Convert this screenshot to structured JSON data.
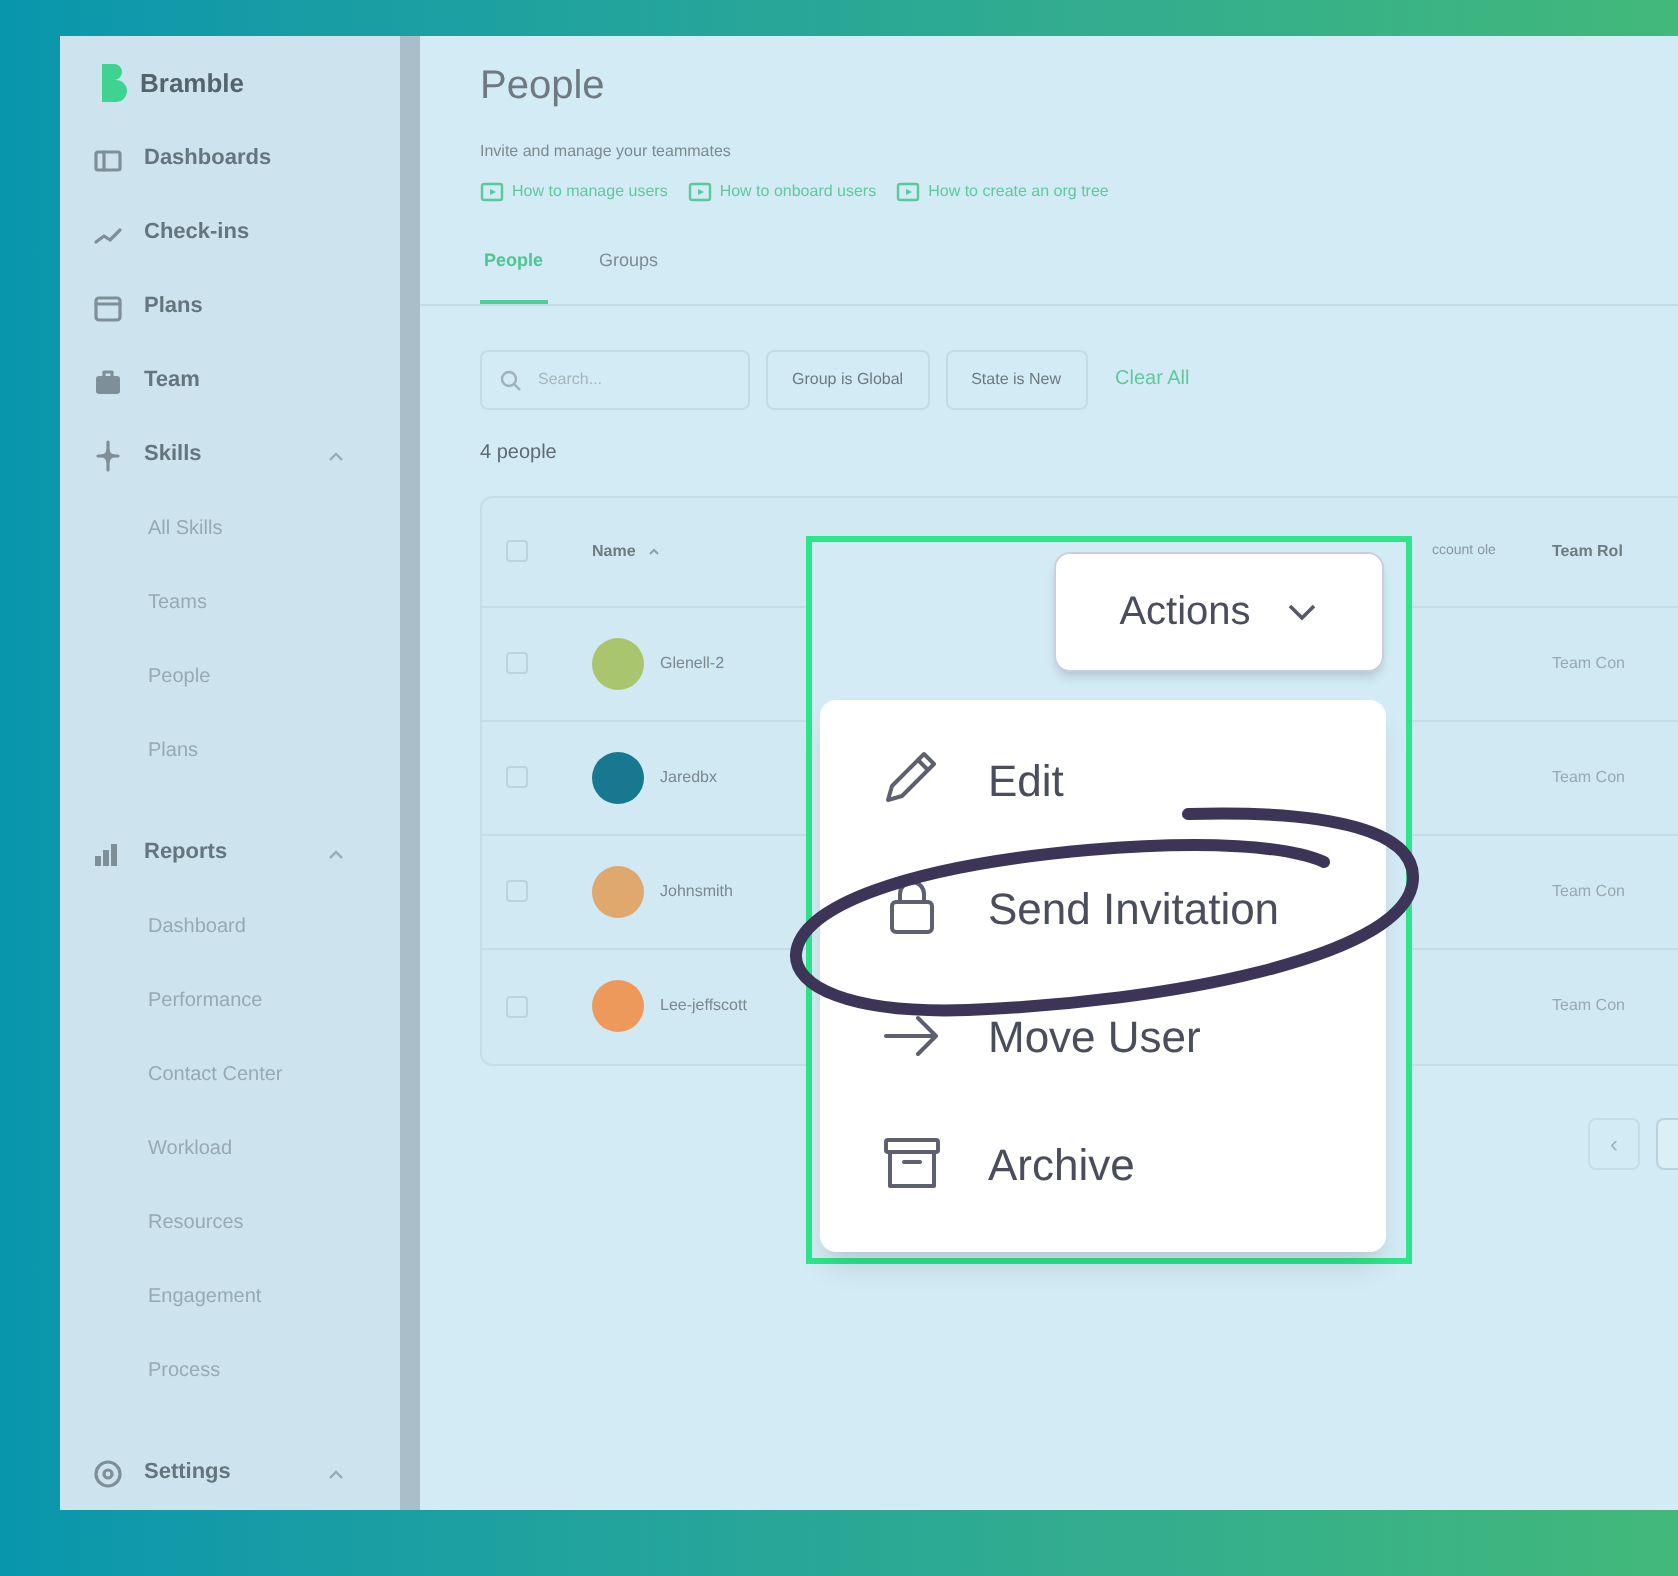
{
  "sidebar": {
    "brand": "Bramble",
    "items": [
      {
        "label": "Dashboards",
        "expanded": false
      },
      {
        "label": "Check-ins",
        "expanded": false
      },
      {
        "label": "Plans",
        "expanded": false
      },
      {
        "label": "Team",
        "expanded": false
      },
      {
        "label": "Skills",
        "expanded": true,
        "children": [
          "All Skills",
          "Teams",
          "People",
          "Plans"
        ]
      },
      {
        "label": "Reports",
        "expanded": true,
        "children": [
          "Dashboard",
          "Performance",
          "Contact Center",
          "Workload",
          "Resources",
          "Engagement",
          "Process"
        ]
      },
      {
        "label": "Settings",
        "expanded": true
      }
    ]
  },
  "page": {
    "title": "People",
    "subtitle": "Invite and manage your teammates",
    "help_links": [
      "How to manage users",
      "How to onboard users",
      "How to create an org tree"
    ]
  },
  "tabs": [
    {
      "label": "People",
      "selected": true
    },
    {
      "label": "Groups",
      "selected": false
    }
  ],
  "filters": {
    "search": {
      "placeholder": "Search..."
    },
    "chips": [
      "Group is Global",
      "State is New"
    ],
    "clear": "Clear All"
  },
  "count": "4 people",
  "table": {
    "all_checked": false,
    "columns": [
      "Name",
      "ccount ole",
      "Team Rol"
    ],
    "rows": [
      {
        "name": "Glenell-2",
        "color": "#a9c56d",
        "role": "Team Con",
        "checked": false
      },
      {
        "name": "Jaredbx",
        "color": "#17788f",
        "role": "Team Con",
        "checked": false
      },
      {
        "name": "Johnsmith",
        "color": "#dfa86c",
        "role": "Team Con",
        "checked": false
      },
      {
        "name": "Lee-jeffscott",
        "color": "#ee995c",
        "role": "Team Con",
        "checked": false
      }
    ]
  },
  "pagination": {
    "prev": "‹"
  },
  "actions": {
    "label": "Actions",
    "menu": [
      {
        "label": "Edit",
        "kind": "edit"
      },
      {
        "label": "Send Invitation",
        "kind": "invite"
      },
      {
        "label": "Move User",
        "kind": "move"
      },
      {
        "label": "Archive",
        "kind": "archive"
      }
    ]
  }
}
